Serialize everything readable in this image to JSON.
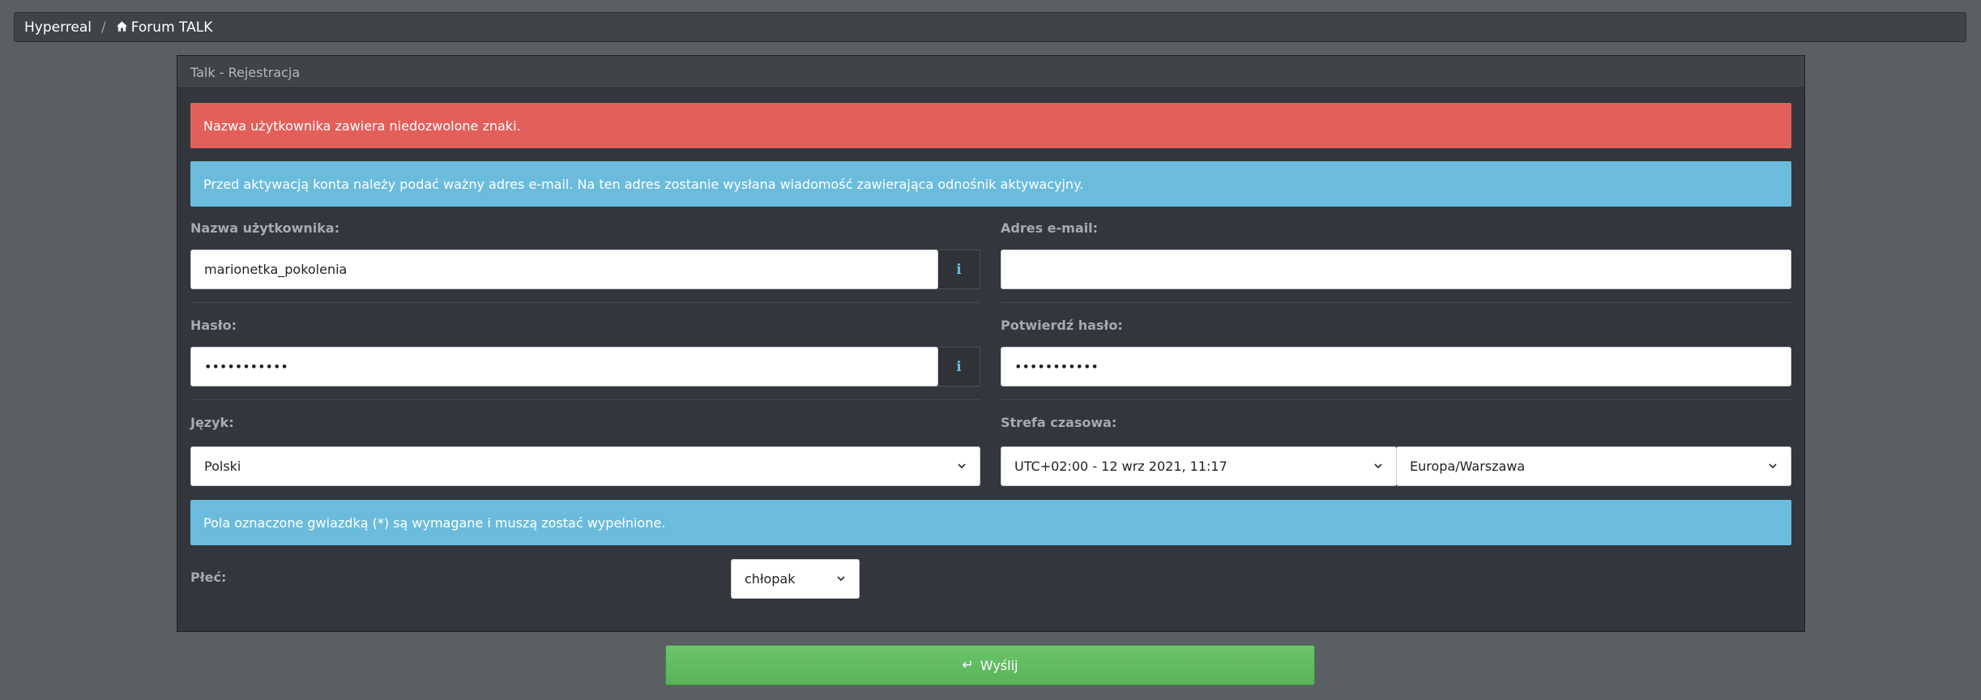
{
  "breadcrumb": {
    "items": [
      "Hyperreal",
      "Forum TALK"
    ],
    "separator": "/"
  },
  "panel": {
    "title": "Talk - Rejestracja"
  },
  "alerts": {
    "error": "Nazwa użytkownika zawiera niedozwolone znaki.",
    "activation_info": "Przed aktywacją konta należy podać ważny adres e-mail. Na ten adres zostanie wysłana wiadomość zawierająca odnośnik aktywacyjny.",
    "required_info": "Pola oznaczone gwiazdką (*) są wymagane i muszą zostać wypełnione."
  },
  "form": {
    "username": {
      "label": "Nazwa użytkownika:",
      "value": "marionetka_pokolenia",
      "info_icon": "info-icon"
    },
    "email": {
      "label": "Adres e-mail:",
      "value": ""
    },
    "password": {
      "label": "Hasło:",
      "value": "•••••••••••",
      "info_icon": "info-icon"
    },
    "password_confirm": {
      "label": "Potwierdź hasło:",
      "value": "•••••••••••"
    },
    "language": {
      "label": "Język:",
      "selected": "Polski"
    },
    "timezone": {
      "label": "Strefa czasowa:",
      "offset_selected": "UTC+02:00 - 12 wrz 2021, 11:17",
      "zone_selected": "Europa/Warszawa"
    },
    "gender": {
      "label": "Płeć:",
      "selected": "chłopak"
    }
  },
  "submit": {
    "label": "Wyślij",
    "icon": "enter-icon"
  },
  "colors": {
    "danger": "#e35f5a",
    "info": "#6bbcdc",
    "success": "#5cb85c",
    "panel_bg": "#33373d",
    "page_bg": "#5b5f63"
  }
}
